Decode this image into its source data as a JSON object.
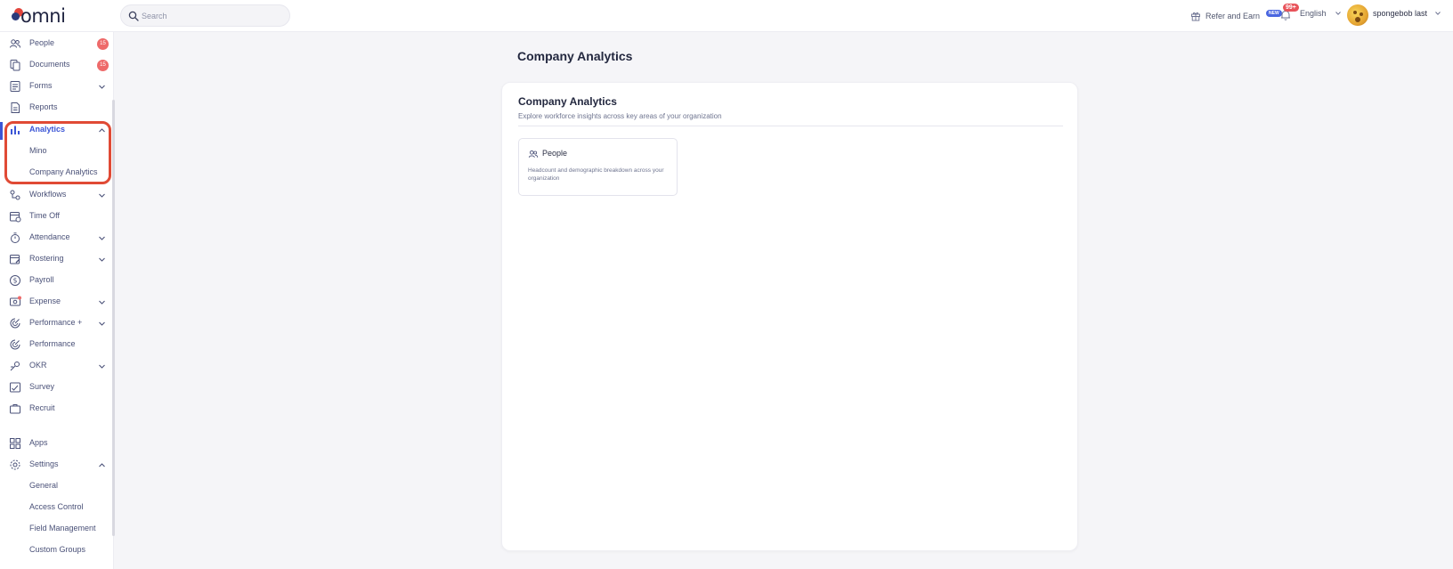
{
  "app": {
    "logo_text": "omni"
  },
  "search": {
    "placeholder": "Search"
  },
  "header": {
    "refer_label": "Refer and Earn",
    "new_badge": "NEW",
    "notifications_badge": "99+",
    "language": "English",
    "user_name": "spongebob last"
  },
  "sidebar": {
    "items": [
      {
        "label": "People",
        "badge": "15"
      },
      {
        "label": "Documents",
        "badge": "15"
      },
      {
        "label": "Forms"
      },
      {
        "label": "Reports"
      },
      {
        "label": "Analytics"
      },
      {
        "label": "Mino"
      },
      {
        "label": "Company Analytics"
      },
      {
        "label": "Workflows"
      },
      {
        "label": "Time Off"
      },
      {
        "label": "Attendance"
      },
      {
        "label": "Rostering"
      },
      {
        "label": "Payroll"
      },
      {
        "label": "Expense"
      },
      {
        "label": "Performance +"
      },
      {
        "label": "Performance"
      },
      {
        "label": "OKR"
      },
      {
        "label": "Survey"
      },
      {
        "label": "Recruit"
      },
      {
        "label": "Apps"
      },
      {
        "label": "Settings"
      },
      {
        "label": "General"
      },
      {
        "label": "Access Control"
      },
      {
        "label": "Field Management"
      },
      {
        "label": "Custom Groups"
      }
    ]
  },
  "main": {
    "page_title": "Company Analytics",
    "panel_title": "Company Analytics",
    "panel_subtitle": "Explore workforce insights across key areas of your organization",
    "cards": [
      {
        "title": "People",
        "description": "Headcount and demographic breakdown across your organization"
      }
    ]
  },
  "colors": {
    "accent": "#3b55d6",
    "badge": "#ee6a6a",
    "highlight": "#e04a35"
  }
}
